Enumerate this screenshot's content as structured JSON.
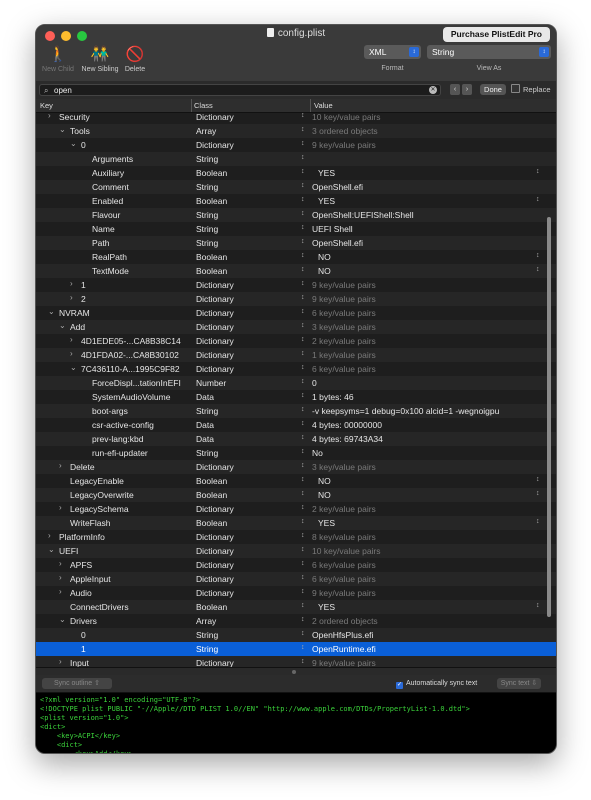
{
  "window": {
    "title": "config.plist",
    "purchase_label": "Purchase PlistEdit Pro"
  },
  "colors": {
    "accent": "#0a5fd7",
    "xml_green": "#3bd33b",
    "close": "#fe5f57",
    "minimize": "#febc2e",
    "zoom": "#28c840"
  },
  "toolbar": {
    "new_child": "New Child",
    "new_sibling": "New Sibling",
    "delete": "Delete",
    "format_value": "XML",
    "format_label": "Format",
    "view_value": "String",
    "view_label": "View As"
  },
  "search": {
    "value": "open",
    "done": "Done",
    "replace": "Replace"
  },
  "columns": {
    "key": "Key",
    "class": "Class",
    "value": "Value"
  },
  "rows": [
    {
      "key": "Security",
      "chevron": "right",
      "class": "Dictionary",
      "value": "10 key/value pairs",
      "dim": true
    },
    {
      "key": "Tools",
      "chevron": "down",
      "class": "Array",
      "value": "3 ordered objects",
      "dim": true
    },
    {
      "key": "0",
      "chevron": "down",
      "class": "Dictionary",
      "value": "9 key/value pairs",
      "dim": true
    },
    {
      "key": "Arguments",
      "chevron": "",
      "class": "String",
      "value": "",
      "dim": false
    },
    {
      "key": "Auxiliary",
      "chevron": "",
      "class": "Boolean",
      "value": "YES",
      "dim": false,
      "popup": true
    },
    {
      "key": "Comment",
      "chevron": "",
      "class": "String",
      "value": "OpenShell.efi",
      "dim": false
    },
    {
      "key": "Enabled",
      "chevron": "",
      "class": "Boolean",
      "value": "YES",
      "dim": false,
      "popup": true
    },
    {
      "key": "Flavour",
      "chevron": "",
      "class": "String",
      "value": "OpenShell:UEFIShell:Shell",
      "dim": false
    },
    {
      "key": "Name",
      "chevron": "",
      "class": "String",
      "value": "UEFI Shell",
      "dim": false
    },
    {
      "key": "Path",
      "chevron": "",
      "class": "String",
      "value": "OpenShell.efi",
      "dim": false
    },
    {
      "key": "RealPath",
      "chevron": "",
      "class": "Boolean",
      "value": "NO",
      "dim": false,
      "popup": true
    },
    {
      "key": "TextMode",
      "chevron": "",
      "class": "Boolean",
      "value": "NO",
      "dim": false,
      "popup": true
    },
    {
      "key": "1",
      "chevron": "right",
      "class": "Dictionary",
      "value": "9 key/value pairs",
      "dim": true
    },
    {
      "key": "2",
      "chevron": "right",
      "class": "Dictionary",
      "value": "9 key/value pairs",
      "dim": true
    },
    {
      "key": "NVRAM",
      "chevron": "down",
      "class": "Dictionary",
      "value": "6 key/value pairs",
      "dim": true
    },
    {
      "key": "Add",
      "chevron": "down",
      "class": "Dictionary",
      "value": "3 key/value pairs",
      "dim": true
    },
    {
      "key": "4D1EDE05-...CA8B38C14",
      "chevron": "right",
      "class": "Dictionary",
      "value": "2 key/value pairs",
      "dim": true
    },
    {
      "key": "4D1FDA02-...CA8B30102",
      "chevron": "right",
      "class": "Dictionary",
      "value": "1 key/value pairs",
      "dim": true
    },
    {
      "key": "7C436110-A...1995C9F82",
      "chevron": "down",
      "class": "Dictionary",
      "value": "6 key/value pairs",
      "dim": true
    },
    {
      "key": "ForceDispl...tationInEFI",
      "chevron": "",
      "class": "Number",
      "value": "0",
      "dim": false
    },
    {
      "key": "SystemAudioVolume",
      "chevron": "",
      "class": "Data",
      "value": "1 bytes: 46",
      "dim": false
    },
    {
      "key": "boot-args",
      "chevron": "",
      "class": "String",
      "value": "-v keepsyms=1 debug=0x100 alcid=1 -wegnoigpu",
      "dim": false
    },
    {
      "key": "csr-active-config",
      "chevron": "",
      "class": "Data",
      "value": "4 bytes: 00000000",
      "dim": false
    },
    {
      "key": "prev-lang:kbd",
      "chevron": "",
      "class": "Data",
      "value": "4 bytes: 69743A34",
      "dim": false
    },
    {
      "key": "run-efi-updater",
      "chevron": "",
      "class": "String",
      "value": "No",
      "dim": false
    },
    {
      "key": "Delete",
      "chevron": "right",
      "class": "Dictionary",
      "value": "3 key/value pairs",
      "dim": true
    },
    {
      "key": "LegacyEnable",
      "chevron": "",
      "class": "Boolean",
      "value": "NO",
      "dim": false,
      "popup": true
    },
    {
      "key": "LegacyOverwrite",
      "chevron": "",
      "class": "Boolean",
      "value": "NO",
      "dim": false,
      "popup": true
    },
    {
      "key": "LegacySchema",
      "chevron": "right",
      "class": "Dictionary",
      "value": "2 key/value pairs",
      "dim": true
    },
    {
      "key": "WriteFlash",
      "chevron": "",
      "class": "Boolean",
      "value": "YES",
      "dim": false,
      "popup": true
    },
    {
      "key": "PlatformInfo",
      "chevron": "right",
      "class": "Dictionary",
      "value": "8 key/value pairs",
      "dim": true
    },
    {
      "key": "UEFI",
      "chevron": "down",
      "class": "Dictionary",
      "value": "10 key/value pairs",
      "dim": true
    },
    {
      "key": "APFS",
      "chevron": "right",
      "class": "Dictionary",
      "value": "6 key/value pairs",
      "dim": true
    },
    {
      "key": "AppleInput",
      "chevron": "right",
      "class": "Dictionary",
      "value": "6 key/value pairs",
      "dim": true
    },
    {
      "key": "Audio",
      "chevron": "right",
      "class": "Dictionary",
      "value": "9 key/value pairs",
      "dim": true
    },
    {
      "key": "ConnectDrivers",
      "chevron": "",
      "class": "Boolean",
      "value": "YES",
      "dim": false,
      "popup": true
    },
    {
      "key": "Drivers",
      "chevron": "down",
      "class": "Array",
      "value": "2 ordered objects",
      "dim": true
    },
    {
      "key": "0",
      "chevron": "",
      "class": "String",
      "value": "OpenHfsPlus.efi",
      "dim": false
    },
    {
      "key": "1",
      "chevron": "",
      "class": "String",
      "value": "OpenRuntime.efi",
      "dim": false,
      "selected": true
    },
    {
      "key": "Input",
      "chevron": "right",
      "class": "Dictionary",
      "value": "9 key/value pairs",
      "dim": true
    }
  ],
  "sync": {
    "outline_label": "Sync outline ⇧",
    "auto_label": "Automatically sync text",
    "text_label": "Sync text ⇩"
  },
  "xml_lines": [
    "<?xml version=\"1.0\" encoding=\"UTF-8\"?>",
    "<!DOCTYPE plist PUBLIC \"-//Apple//DTD PLIST 1.0//EN\" \"http://www.apple.com/DTDs/PropertyList-1.0.dtd\">",
    "<plist version=\"1.0\">",
    "<dict>",
    "    <key>ACPI</key>",
    "    <dict>",
    "        <key>Add</key>"
  ]
}
